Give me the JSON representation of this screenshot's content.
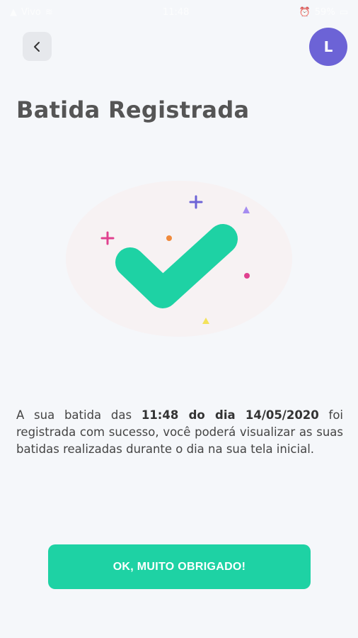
{
  "status_bar": {
    "carrier": "Vivo",
    "time": "11:48",
    "battery": "59%"
  },
  "header": {
    "back_icon": "chevron-left-icon",
    "avatar_initial": "L"
  },
  "title": "Batida Registrada",
  "illustration": {
    "icon": "checkmark-icon",
    "check_color": "#1ed2a4"
  },
  "message": {
    "part1": "A sua batida das ",
    "time": "11:48",
    "part2": " do dia ",
    "date": "14/05/2020",
    "part3": " foi registrada com sucesso, você poderá visualizar as suas batidas realizadas durante o dia na sua tela inicial."
  },
  "ok_button_label": "OK, MUITO OBRIGADO!",
  "colors": {
    "accent": "#1ed2a4",
    "avatar": "#6c63d6",
    "background": "#f5f7fa"
  }
}
